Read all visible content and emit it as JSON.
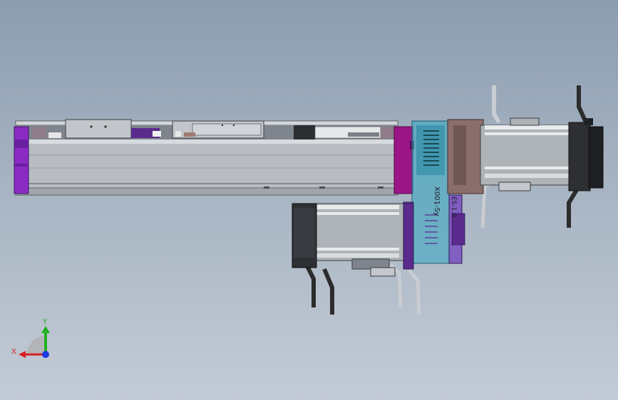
{
  "model": {
    "colors": {
      "aluminum": "#b9bdc3",
      "rail_dark": "#56595e",
      "end_cap": "#8a2cc4",
      "coupling_block": "#9b1587",
      "housing": "#33a8c2",
      "pulley_cover": "#8a6e6a",
      "motor_body": "#aeb3b8",
      "motor_flange": "#2e2f33",
      "cable": "#2c2c2c",
      "pipe": "#c9ccd2"
    },
    "housing_text": "X001-Sy",
    "cover_text": "ES-1.0"
  },
  "triad": {
    "x_label": "X",
    "y_label": "Y",
    "x_color": "#d62020",
    "y_color": "#20b020",
    "z_color": "#1a3ce0"
  }
}
